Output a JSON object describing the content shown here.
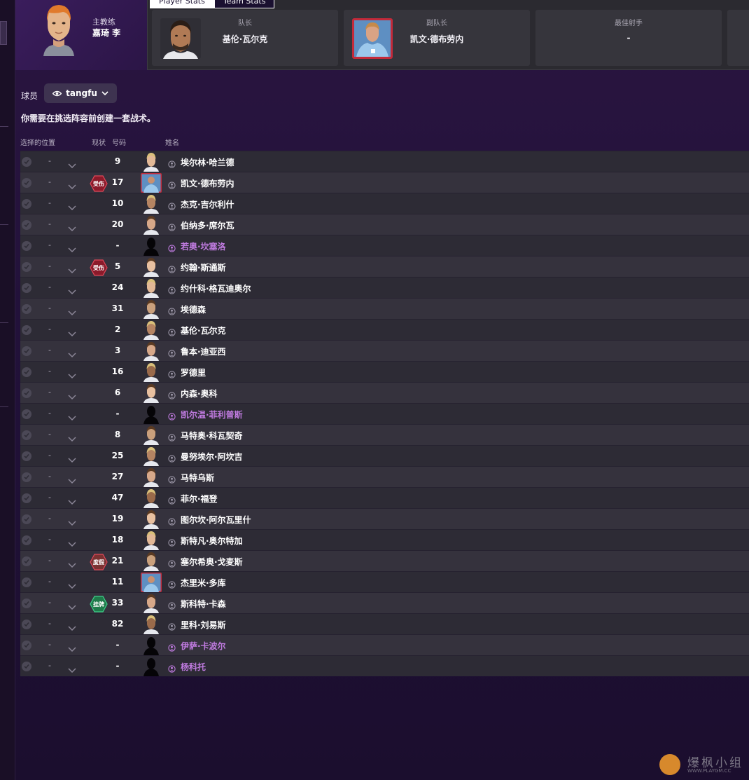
{
  "coach": {
    "role": "主教练",
    "name": "嘉琦 李"
  },
  "tabs": [
    {
      "label": "Player Stats",
      "active": true
    },
    {
      "label": "Team Stats",
      "active": false
    }
  ],
  "stats": {
    "captain": {
      "label": "队长",
      "value": "基伦·瓦尔克"
    },
    "vice_captain": {
      "label": "副队长",
      "value": "凯文·德布劳内"
    },
    "top_scorer": {
      "label": "最佳射手",
      "value": "-"
    }
  },
  "players_label": "球员",
  "view_selector": {
    "value": "tangfu",
    "icon": "eye-icon"
  },
  "notice": "你需要在挑选阵容前创建一套战术。",
  "columns": {
    "selected_position": "选择的位置",
    "status": "现状",
    "number": "号码",
    "name": "姓名"
  },
  "status_colors": {
    "injured": "#8b1a2a",
    "vacation": "#7a3232",
    "listed": "#1f7a4a",
    "loan": "#c07be0"
  },
  "players": [
    {
      "position": "-",
      "status": "",
      "number": "9",
      "name": "埃尔林·哈兰德",
      "loan": false,
      "photo": "face"
    },
    {
      "position": "-",
      "status": "受伤",
      "status_type": "injured",
      "number": "17",
      "name": "凯文·德布劳内",
      "loan": false,
      "photo": "kit"
    },
    {
      "position": "-",
      "status": "",
      "number": "10",
      "name": "杰克·吉尔利什",
      "loan": false,
      "photo": "face"
    },
    {
      "position": "-",
      "status": "",
      "number": "20",
      "name": "伯纳多·席尔瓦",
      "loan": false,
      "photo": "face"
    },
    {
      "position": "-",
      "status": "",
      "number": "-",
      "name": "若奥·坎塞洛",
      "loan": true,
      "photo": "silhouette"
    },
    {
      "position": "-",
      "status": "受伤",
      "status_type": "injured",
      "number": "5",
      "name": "约翰·斯通斯",
      "loan": false,
      "photo": "face"
    },
    {
      "position": "-",
      "status": "",
      "number": "24",
      "name": "约什科·格瓦迪奥尔",
      "loan": false,
      "photo": "face"
    },
    {
      "position": "-",
      "status": "",
      "number": "31",
      "name": "埃德森",
      "loan": false,
      "photo": "face"
    },
    {
      "position": "-",
      "status": "",
      "number": "2",
      "name": "基伦·瓦尔克",
      "loan": false,
      "photo": "face"
    },
    {
      "position": "-",
      "status": "",
      "number": "3",
      "name": "鲁本·迪亚西",
      "loan": false,
      "photo": "face"
    },
    {
      "position": "-",
      "status": "",
      "number": "16",
      "name": "罗德里",
      "loan": false,
      "photo": "face"
    },
    {
      "position": "-",
      "status": "",
      "number": "6",
      "name": "内森·奥科",
      "loan": false,
      "photo": "face"
    },
    {
      "position": "-",
      "status": "",
      "number": "-",
      "name": "凯尔温·菲利普斯",
      "loan": true,
      "photo": "silhouette"
    },
    {
      "position": "-",
      "status": "",
      "number": "8",
      "name": "马特奥·科瓦契奇",
      "loan": false,
      "photo": "face"
    },
    {
      "position": "-",
      "status": "",
      "number": "25",
      "name": "曼努埃尔·阿坎吉",
      "loan": false,
      "photo": "face"
    },
    {
      "position": "-",
      "status": "",
      "number": "27",
      "name": "马特乌斯",
      "loan": false,
      "photo": "face"
    },
    {
      "position": "-",
      "status": "",
      "number": "47",
      "name": "菲尔·福登",
      "loan": false,
      "photo": "face"
    },
    {
      "position": "-",
      "status": "",
      "number": "19",
      "name": "图尔坎·阿尔瓦里什",
      "loan": false,
      "photo": "face"
    },
    {
      "position": "-",
      "status": "",
      "number": "18",
      "name": "斯特凡·奥尔特加",
      "loan": false,
      "photo": "face"
    },
    {
      "position": "-",
      "status": "度假",
      "status_type": "vacation",
      "number": "21",
      "name": "塞尔希奥·戈麦斯",
      "loan": false,
      "photo": "face"
    },
    {
      "position": "-",
      "status": "",
      "number": "11",
      "name": "杰里米·多库",
      "loan": false,
      "photo": "kit"
    },
    {
      "position": "-",
      "status": "挂牌",
      "status_type": "listed",
      "number": "33",
      "name": "斯科特·卡森",
      "loan": false,
      "photo": "face"
    },
    {
      "position": "-",
      "status": "",
      "number": "82",
      "name": "里科·刘易斯",
      "loan": false,
      "photo": "face"
    },
    {
      "position": "-",
      "status": "",
      "number": "-",
      "name": "伊萨·卡波尔",
      "loan": true,
      "photo": "silhouette"
    },
    {
      "position": "-",
      "status": "",
      "number": "-",
      "name": "杨科托",
      "loan": true,
      "photo": "silhouette"
    }
  ],
  "watermark": {
    "title": "爆枫小组",
    "site": "WWW.PLAYGM.CC"
  }
}
